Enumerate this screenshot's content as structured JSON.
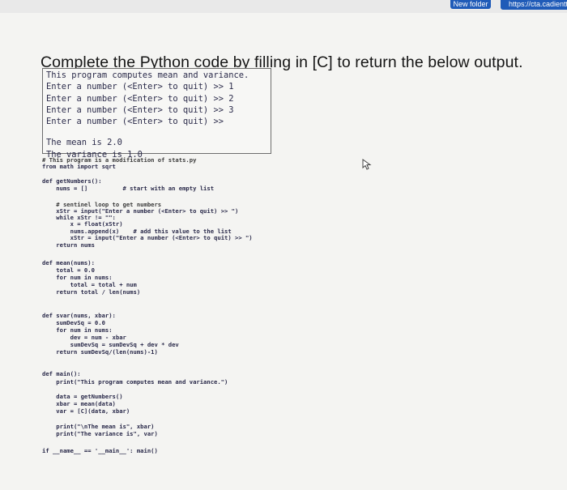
{
  "browser": {
    "folder_tab": "New folder",
    "url_tab": "https://cta.cadientt"
  },
  "question": {
    "title": "Complete the Python code by filling in [C] to return the below output."
  },
  "output": {
    "lines_top": [
      "This program computes mean and variance.",
      "Enter a number (<Enter> to quit) >> 1",
      "Enter a number (<Enter> to quit) >> 2",
      "Enter a number (<Enter> to quit) >> 3",
      "Enter a number (<Enter> to quit) >>"
    ],
    "lines_bottom": [
      "The mean is 2.0",
      "The variance is 1.0"
    ]
  },
  "code": [
    "# This program is a modification of stats.py",
    "from math import sqrt",
    "def getNumbers():",
    "    nums = []          # start with an empty list",
    "    # sentinel loop to get numbers",
    "    xStr = input(\"Enter a number (<Enter> to quit) >> \")",
    "    while xStr != \"\":",
    "        x = float(xStr)",
    "        nums.append(x)    # add this value to the list",
    "        xStr = input(\"Enter a number (<Enter> to quit) >> \")",
    "    return nums",
    "def mean(nums):",
    "    total = 0.0",
    "    for num in nums:",
    "        total = total + num",
    "    return total / len(nums)",
    "def svar(nums, xbar):",
    "    sumDevSq = 0.0",
    "    for num in nums:",
    "        dev = num - xbar",
    "        sumDevSq = sumDevSq + dev * dev",
    "    return sumDevSq/(len(nums)-1)",
    "def main():",
    "    print(\"This program computes mean and variance.\")",
    "    data = getNumbers()",
    "    xbar = mean(data)",
    "    var = [C](data, xbar)",
    "    print(\"\\nThe mean is\", xbar)",
    "    print(\"The variance is\", var)",
    "if __name__ == '__main__': main()"
  ]
}
